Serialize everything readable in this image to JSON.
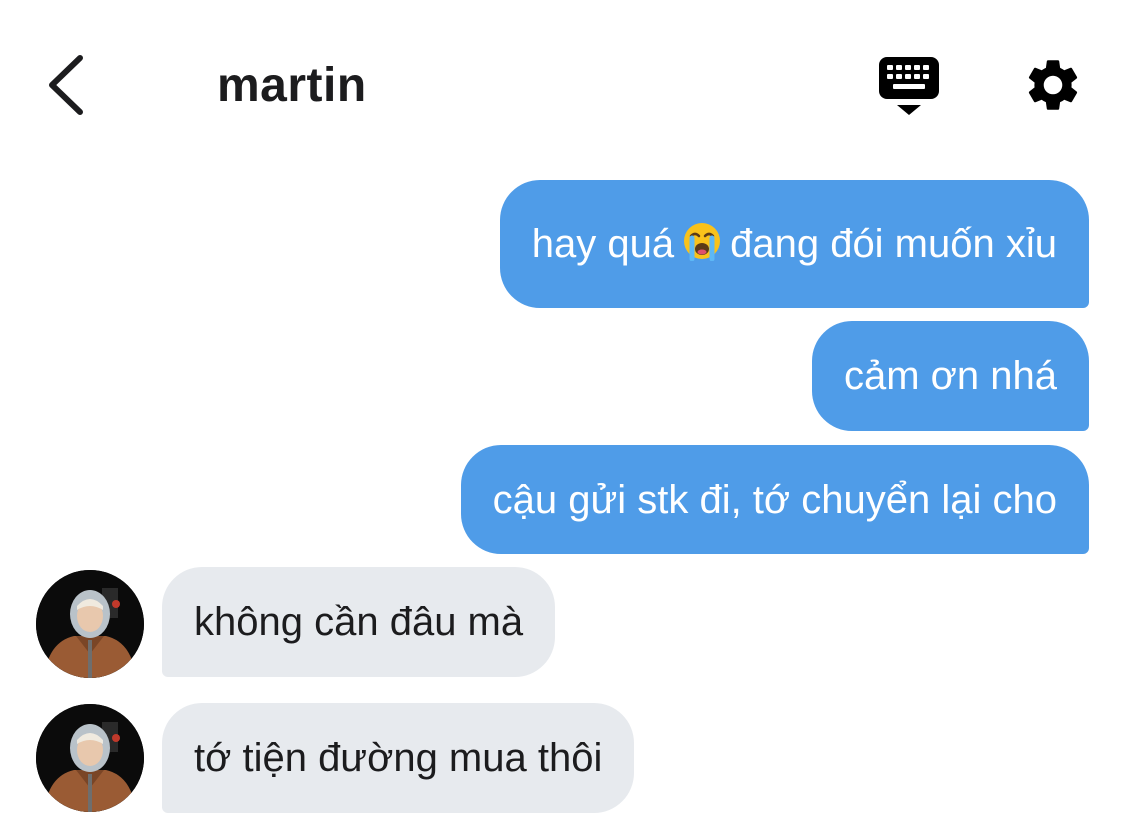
{
  "header": {
    "title": "martin",
    "back_icon": "chevron-left-icon",
    "keyboard_icon": "keyboard-icon",
    "settings_icon": "gear-icon"
  },
  "messages": [
    {
      "direction": "sent",
      "text_before": "hay quá",
      "emoji": "loudly-crying-face",
      "text_after": "đang đói muốn xỉu"
    },
    {
      "direction": "sent",
      "text": "cảm ơn nhá"
    },
    {
      "direction": "sent",
      "text": "cậu gửi stk đi, tớ chuyển lại cho"
    },
    {
      "direction": "received",
      "text": "không cần đâu mà"
    },
    {
      "direction": "received",
      "text": "tớ tiện đường mua thôi"
    }
  ],
  "colors": {
    "sent_bubble": "#4f9ce8",
    "received_bubble": "#e7eaee",
    "text_dark": "#1c1c1e",
    "text_light": "#ffffff"
  }
}
